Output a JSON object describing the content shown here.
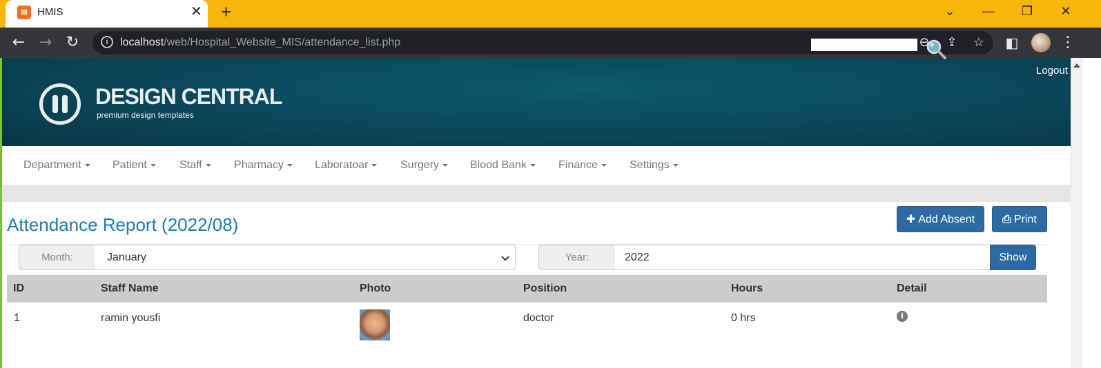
{
  "browser": {
    "tab_title": "HMIS",
    "favicon_text": "⊠",
    "url_host": "localhost",
    "url_path": "/web/Hospital_Website_MIS/attendance_list.php",
    "accent_color": "#f9b50a"
  },
  "header": {
    "logo_title": "DESIGN CENTRAL",
    "logo_subtitle": "premium design templates",
    "logout_label": "Logout",
    "search_value": ""
  },
  "nav": {
    "items": [
      {
        "label": "Department"
      },
      {
        "label": "Patient"
      },
      {
        "label": "Staff"
      },
      {
        "label": "Pharmacy"
      },
      {
        "label": "Laboratoar"
      },
      {
        "label": "Surgery"
      },
      {
        "label": "Blood Bank"
      },
      {
        "label": "Finance"
      },
      {
        "label": "Settings"
      }
    ]
  },
  "page": {
    "title": "Attendance Report (2022/08)",
    "add_absent_label": "Add Absent",
    "print_label": "Print"
  },
  "filters": {
    "month_label": "Month:",
    "month_value": "January",
    "year_label": "Year:",
    "year_value": "2022",
    "show_label": "Show"
  },
  "table": {
    "headers": [
      "ID",
      "Staff Name",
      "Photo",
      "Position",
      "Hours",
      "Detail"
    ],
    "rows": [
      {
        "id": "1",
        "name": "ramin yousfi",
        "photo": "staff-photo",
        "position": "doctor",
        "hours": "0 hrs",
        "detail": "info-icon"
      }
    ]
  }
}
